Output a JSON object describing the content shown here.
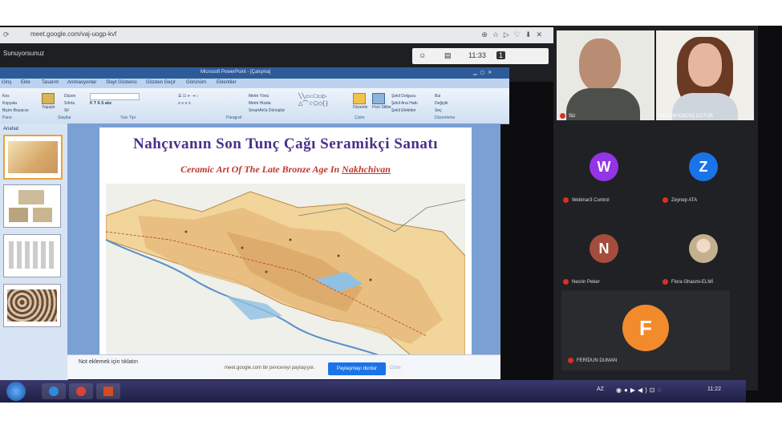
{
  "browser": {
    "url": "meet.google.com/vaj-uogp-kvf",
    "tab_title": "Sunuyorsunuz"
  },
  "meet_controls": {
    "time": "11:33",
    "count": "1"
  },
  "powerpoint": {
    "title": "Microsoft PowerPoint - [Çalışma]",
    "tabs": [
      "Giriş",
      "Ekle",
      "Tasarım",
      "Animasyonlar",
      "Slayt Gösterisi",
      "Gözden Geçir",
      "Görünüm",
      "Eklentiler"
    ],
    "groups": [
      "Pano",
      "Slaytlar",
      "Yazı Tipi",
      "Paragraf",
      "Çizim",
      "Düzenleme"
    ],
    "ribbon_items": {
      "paste": "Yapıştır",
      "cut": "Kes",
      "copy": "Kopyala",
      "format_painter": "Biçim Boyacısı",
      "new_slide": "Yeni Slayt",
      "layout": "Düzen",
      "reset": "Sıfırla",
      "delete": "Sil",
      "text_direction": "Metin Yönü",
      "align_text": "Metni Hizala",
      "smartart": "SmartArt'a Dönüştür",
      "arrange": "Düzenle",
      "quick_styles": "Hızlı Stiller",
      "shape_fill": "Şekil Dolgusu",
      "shape_outline": "Şekil Ana Hattı",
      "shape_effects": "Şekil Efektleri",
      "find": "Bul",
      "replace": "Değiştir",
      "select": "Seç"
    },
    "outline_tab": "Anahat",
    "notes_placeholder": "Not eklemek için tıklatın"
  },
  "slide": {
    "title": "Nahçıvanın Son Tunç Çağı  Seramikçi  Sanatı",
    "subtitle_main": "Ceramic Art Of The Late Bronze Age In ",
    "subtitle_place": "Nakhchivan"
  },
  "share_notice": {
    "message": "meet.google.com bir pencereyi paylaşıyor.",
    "stop_button": "Paylaşmayı durdur",
    "hide_button": "Gizle"
  },
  "participants": {
    "video": [
      {
        "name": "Siz",
        "skin": "#b98c74",
        "bg": "#e9e9e3"
      },
      {
        "name": "GÜLEM KOÇAŞ ÇOTUR",
        "skin": "#e6b7a0",
        "bg": "#f0efea"
      }
    ],
    "tiles": [
      {
        "initial": "W",
        "name": "Webinar3 Control",
        "color": "#9334e6"
      },
      {
        "initial": "Z",
        "name": "Zeynep ATA",
        "color": "#1a73e8"
      },
      {
        "initial": "N",
        "name": "Nesrin Peker",
        "color": "#a54d3c"
      },
      {
        "initial": "",
        "name": "Flora Ghasmi-ELMİ",
        "color": "#c4b08f"
      },
      {
        "initial": "F",
        "name": "FERİDUN DUMAN",
        "color": "#f28b2c"
      }
    ]
  },
  "taskbar": {
    "language": "AZ",
    "clock": "11:22"
  }
}
